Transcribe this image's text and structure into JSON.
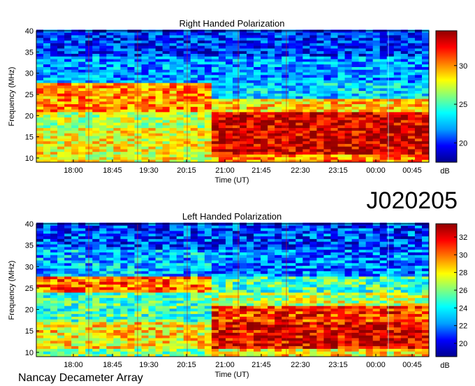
{
  "observation_id": "J020205",
  "footer": "Nancay Decameter Array",
  "chart_data": [
    {
      "type": "heatmap",
      "title": "Right Handed Polarization",
      "xlabel": "Time (UT)",
      "ylabel": "Frequency (MHz)",
      "x_ticks": [
        "18:00",
        "18:45",
        "19:30",
        "20:15",
        "21:00",
        "21:45",
        "22:30",
        "23:15",
        "00:00",
        "00:45"
      ],
      "y_ticks": [
        10,
        15,
        20,
        25,
        30,
        35,
        40
      ],
      "ylim": [
        9,
        40
      ],
      "colorbar": {
        "label": "dB",
        "ticks": [
          20,
          25,
          30
        ],
        "range": [
          17.5,
          34.5
        ]
      },
      "colormap": [
        "#00008f",
        "#0000ff",
        "#00a0ff",
        "#00ffff",
        "#7fff7f",
        "#ffff00",
        "#ff7f00",
        "#ff0000",
        "#8f0000"
      ],
      "intensity_bands": [
        {
          "f_min": 9,
          "f_max": 11,
          "before_2050": 28,
          "after_2050": 30
        },
        {
          "f_min": 11,
          "f_max": 17,
          "before_2050": 28,
          "after_2050": 33
        },
        {
          "f_min": 17,
          "f_max": 21,
          "before_2050": 27,
          "after_2050": 33
        },
        {
          "f_min": 21,
          "f_max": 24,
          "before_2050": 30,
          "after_2050": 29
        },
        {
          "f_min": 24,
          "f_max": 28,
          "before_2050": 30,
          "after_2050": 23
        },
        {
          "f_min": 28,
          "f_max": 34,
          "before_2050": 22,
          "after_2050": 22
        },
        {
          "f_min": 34,
          "f_max": 40,
          "before_2050": 20,
          "after_2050": 20
        }
      ]
    },
    {
      "type": "heatmap",
      "title": "Left Handed Polarization",
      "xlabel": "Time (UT)",
      "ylabel": "Frequency (MHz)",
      "x_ticks": [
        "18:00",
        "18:45",
        "19:30",
        "20:15",
        "21:00",
        "21:45",
        "22:30",
        "23:15",
        "00:00",
        "00:45"
      ],
      "y_ticks": [
        10,
        15,
        20,
        25,
        30,
        35,
        40
      ],
      "ylim": [
        9,
        40
      ],
      "colorbar": {
        "label": "dB",
        "ticks": [
          20,
          22,
          24,
          26,
          28,
          30,
          32
        ],
        "range": [
          18.5,
          33.5
        ]
      },
      "colormap": [
        "#00008f",
        "#0000ff",
        "#00a0ff",
        "#00ffff",
        "#7fff7f",
        "#ffff00",
        "#ff7f00",
        "#ff0000",
        "#8f0000"
      ],
      "intensity_bands": [
        {
          "f_min": 9,
          "f_max": 11,
          "before_2050": 26,
          "after_2050": 28
        },
        {
          "f_min": 11,
          "f_max": 17,
          "before_2050": 28,
          "after_2050": 32
        },
        {
          "f_min": 17,
          "f_max": 21,
          "before_2050": 25,
          "after_2050": 31
        },
        {
          "f_min": 21,
          "f_max": 24,
          "before_2050": 25,
          "after_2050": 27
        },
        {
          "f_min": 24,
          "f_max": 28,
          "before_2050": 30,
          "after_2050": 25
        },
        {
          "f_min": 28,
          "f_max": 34,
          "before_2050": 23,
          "after_2050": 22
        },
        {
          "f_min": 34,
          "f_max": 40,
          "before_2050": 21,
          "after_2050": 21
        }
      ]
    }
  ]
}
